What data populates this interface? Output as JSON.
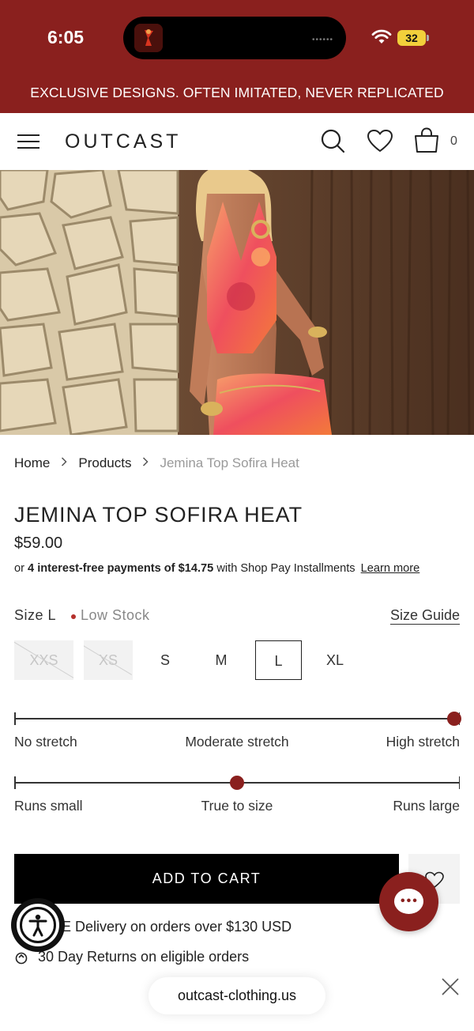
{
  "status_bar": {
    "time": "6:05",
    "battery": "32"
  },
  "promo": {
    "text": "EXCLUSIVE DESIGNS. OFTEN IMITATED, NEVER REPLICATED"
  },
  "header": {
    "brand": "OUTCAST",
    "cart_count": "0"
  },
  "breadcrumb": {
    "home": "Home",
    "products": "Products",
    "current": "Jemina Top Sofira Heat"
  },
  "product": {
    "title": "JEMINA TOP SOFIRA HEAT",
    "price": "$59.00",
    "installments": {
      "prefix": "or",
      "bold": "4 interest-free payments of",
      "amount": "$14.75",
      "suffix": "with Shop Pay Installments",
      "link": "Learn more"
    }
  },
  "size": {
    "label": "Size L",
    "stock": "Low Stock",
    "guide": "Size Guide",
    "options": [
      {
        "label": "XXS",
        "state": "unavailable"
      },
      {
        "label": "XS",
        "state": "unavailable"
      },
      {
        "label": "S",
        "state": "available"
      },
      {
        "label": "M",
        "state": "available"
      },
      {
        "label": "L",
        "state": "selected"
      },
      {
        "label": "XL",
        "state": "available"
      }
    ]
  },
  "fit": {
    "stretch": {
      "labels": [
        "No stretch",
        "Moderate stretch",
        "High stretch"
      ],
      "level": 1.0
    },
    "sizing": {
      "labels": [
        "Runs small",
        "True to size",
        "Runs large"
      ],
      "level": 0.5
    },
    "accent_color": "#8a201e"
  },
  "cart": {
    "add_label": "ADD TO CART"
  },
  "benefits": {
    "delivery": "E Delivery on orders over $130 USD",
    "returns": "30 Day Returns on eligible orders"
  },
  "browser": {
    "url": "outcast-clothing.us"
  },
  "icons": [
    "menu-icon",
    "search-icon",
    "heart-icon",
    "bag-icon",
    "wifi-icon",
    "chevron-right-icon",
    "chat-icon",
    "accessibility-icon",
    "returns-icon",
    "close-icon"
  ],
  "colors": {
    "brand": "#8a201e",
    "button": "#000000"
  }
}
